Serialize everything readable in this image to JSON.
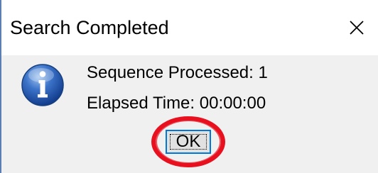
{
  "window": {
    "title": "Search Completed",
    "close_icon": "close-icon"
  },
  "message": {
    "icon": "info-icon",
    "line1": "Sequence Processed: 1",
    "line2": "Elapsed Time: 00:00:00"
  },
  "buttons": {
    "ok_label": "OK"
  },
  "annotation": {
    "ring_color": "#e8101e"
  },
  "colors": {
    "border_accent": "#5b7fb2",
    "button_focus": "#0078d7",
    "client_background": "#f0f0f0"
  }
}
